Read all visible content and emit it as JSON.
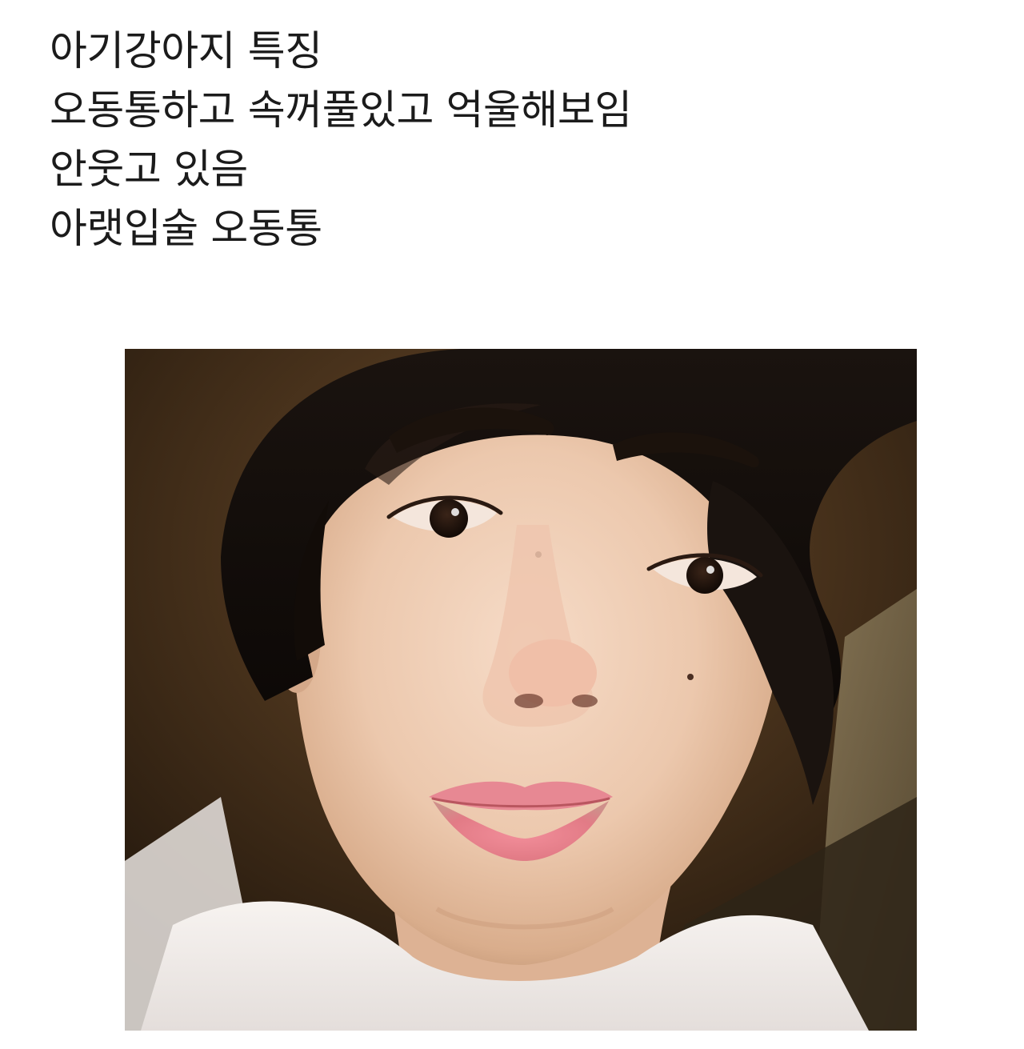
{
  "post": {
    "lines": [
      "아기강아지 특징",
      "오동통하고 속꺼풀있고 억울해보임",
      "안웃고 있음",
      "아랫입술 오동통"
    ]
  },
  "photo": {
    "subject": "selfie-portrait"
  }
}
